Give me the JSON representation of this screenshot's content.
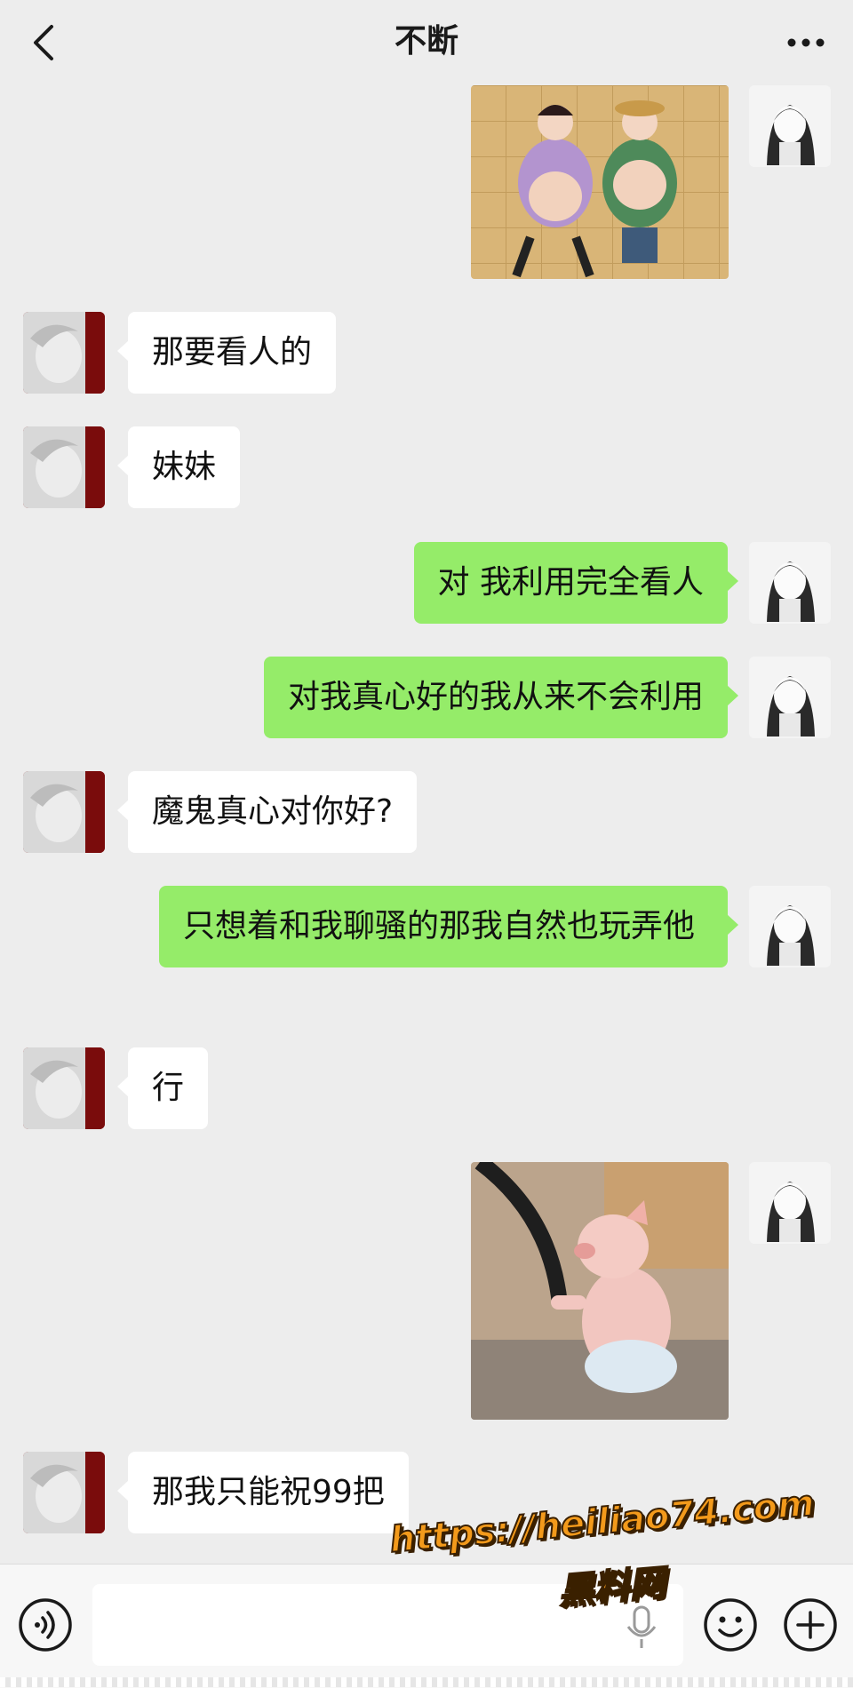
{
  "header": {
    "title": "不断",
    "back_icon": "chevron-left-icon",
    "more_icon": "more-dots-icon"
  },
  "messages": [
    {
      "sender": "me",
      "type": "image",
      "image": "two-chubby-cartoon-kids-lying-on-floor"
    },
    {
      "sender": "other",
      "type": "text",
      "text": "那要看人的"
    },
    {
      "sender": "other",
      "type": "text",
      "text": "妹妹"
    },
    {
      "sender": "me",
      "type": "text",
      "text": "对 我利用完全看人"
    },
    {
      "sender": "me",
      "type": "text",
      "text": "对我真心好的我从来不会利用"
    },
    {
      "sender": "other",
      "type": "text",
      "text": "魔鬼真心对你好?"
    },
    {
      "sender": "me",
      "type": "text",
      "text": "只想着和我聊骚的那我自然也玩弄他"
    },
    {
      "sender": "other",
      "type": "text",
      "text": "行"
    },
    {
      "sender": "me",
      "type": "image",
      "image": "piglet-in-diaper-driving-car"
    },
    {
      "sender": "other",
      "type": "text",
      "text": "那我只能祝99把"
    }
  ],
  "input_bar": {
    "voice_icon": "voice-icon",
    "input_value": "",
    "mic_icon": "mic-icon",
    "emoji_icon": "emoji-icon",
    "plus_icon": "plus-icon"
  },
  "watermark": {
    "url": "https://heiliao74.com",
    "label": "黑料网"
  },
  "colors": {
    "background": "#ededed",
    "my_bubble": "#95ec69",
    "their_bubble": "#ffffff",
    "watermark": "#f39a1b"
  }
}
